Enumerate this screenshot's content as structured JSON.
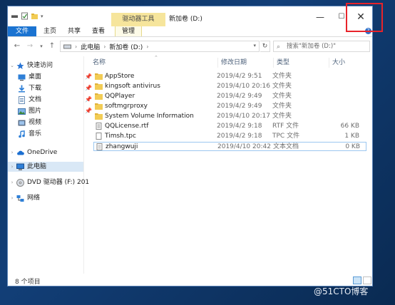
{
  "window": {
    "title": "新加卷 (D:)",
    "context_tab": "驱动器工具",
    "help": "?"
  },
  "controls": {
    "minimize": "—",
    "maximize": "☐",
    "close": "✕"
  },
  "ribbon": {
    "tabs": [
      "文件",
      "主页",
      "共享",
      "查看",
      "管理"
    ]
  },
  "nav": {
    "back": "←",
    "forward": "→",
    "recent": "▾",
    "up": "↑",
    "refresh": "↻"
  },
  "address": {
    "segments": [
      "此电脑",
      "新加卷 (D:)"
    ],
    "dropdown": "▾"
  },
  "search": {
    "placeholder": "搜索\"新加卷 (D:)\""
  },
  "sidebar": {
    "items": [
      {
        "label": "快速访问",
        "icon": "star-icon",
        "pinned": false
      },
      {
        "label": "桌面",
        "icon": "desktop-icon",
        "pinned": true
      },
      {
        "label": "下载",
        "icon": "download-icon",
        "pinned": true
      },
      {
        "label": "文档",
        "icon": "document-icon",
        "pinned": true
      },
      {
        "label": "图片",
        "icon": "pictures-icon",
        "pinned": true
      },
      {
        "label": "视频",
        "icon": "video-icon",
        "pinned": false
      },
      {
        "label": "音乐",
        "icon": "music-icon",
        "pinned": false
      },
      {
        "label": "OneDrive",
        "icon": "cloud-icon",
        "pinned": false
      },
      {
        "label": "此电脑",
        "icon": "computer-icon",
        "pinned": false
      },
      {
        "label": "DVD 驱动器 (F:) 201",
        "icon": "dvd-icon",
        "pinned": false
      },
      {
        "label": "网络",
        "icon": "network-icon",
        "pinned": false
      }
    ]
  },
  "columns": {
    "name": "名称",
    "date": "修改日期",
    "type": "类型",
    "size": "大小"
  },
  "files": [
    {
      "name": "AppStore",
      "date": "2019/4/2 9:51",
      "type": "文件夹",
      "size": "",
      "kind": "folder"
    },
    {
      "name": "kingsoft antivirus",
      "date": "2019/4/10 20:16",
      "type": "文件夹",
      "size": "",
      "kind": "folder"
    },
    {
      "name": "QQPlayer",
      "date": "2019/4/2 9:49",
      "type": "文件夹",
      "size": "",
      "kind": "folder"
    },
    {
      "name": "softmgrproxy",
      "date": "2019/4/2 9:49",
      "type": "文件夹",
      "size": "",
      "kind": "folder"
    },
    {
      "name": "System Volume Information",
      "date": "2019/4/10 20:17",
      "type": "文件夹",
      "size": "",
      "kind": "folder"
    },
    {
      "name": "QQLicense.rtf",
      "date": "2019/4/2 9:18",
      "type": "RTF 文件",
      "size": "66 KB",
      "kind": "file"
    },
    {
      "name": "Timsh.tpc",
      "date": "2019/4/2 9:18",
      "type": "TPC 文件",
      "size": "1 KB",
      "kind": "file"
    },
    {
      "name": "zhangwuji",
      "date": "2019/4/10 20:42",
      "type": "文本文档",
      "size": "0 KB",
      "kind": "file"
    }
  ],
  "status": {
    "count": "8 个项目"
  },
  "watermark": "@51CTO博客",
  "colors": {
    "accent": "#1a73d1",
    "highlight_box": "#e8232a",
    "folder": "#f2cc55",
    "context_tab": "#f6e59c"
  }
}
